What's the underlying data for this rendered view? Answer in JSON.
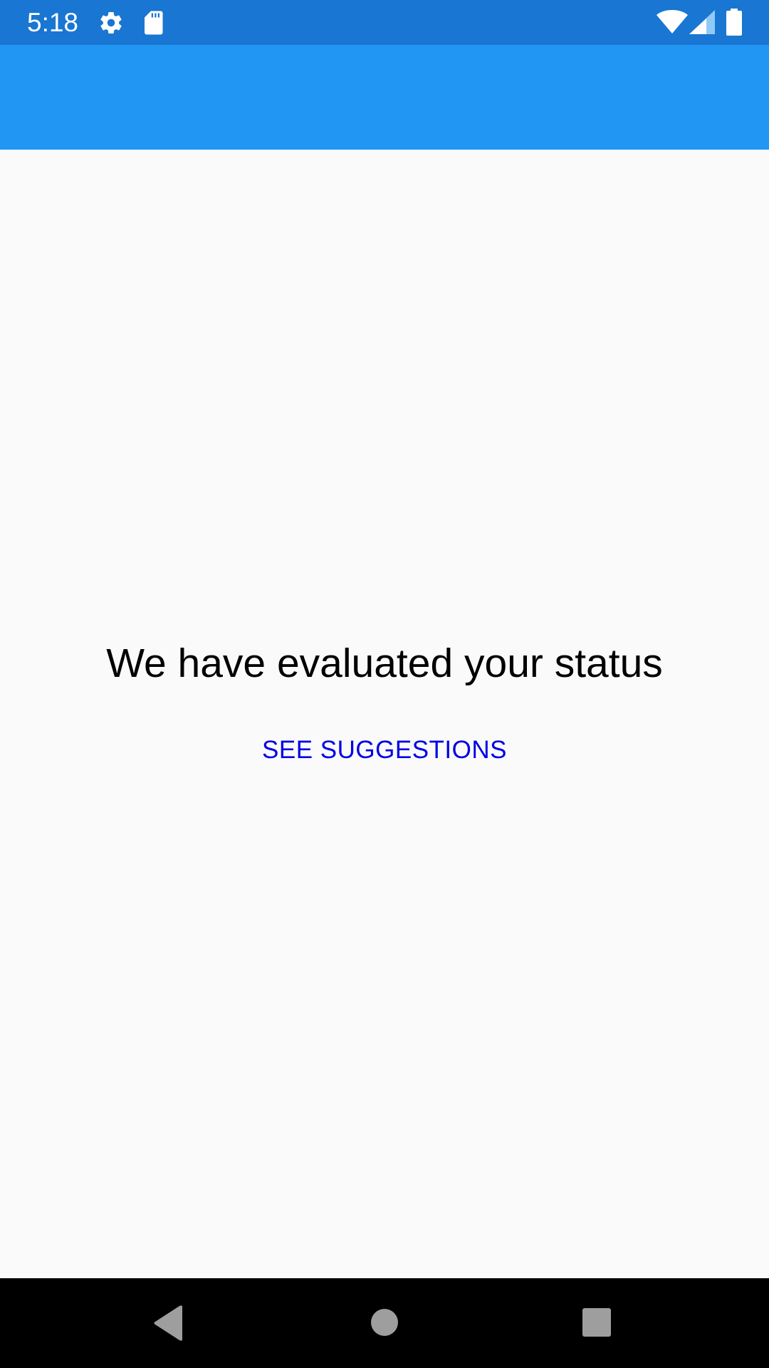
{
  "status_bar": {
    "time": "5:18",
    "icons": [
      "gear-icon",
      "sd-card-icon",
      "wifi-icon",
      "signal-icon",
      "battery-icon"
    ],
    "background": "#1976d2"
  },
  "app_bar": {
    "background": "#2196f3"
  },
  "main": {
    "headline": "We have evaluated your status",
    "suggestions_button": "SEE SUGGESTIONS",
    "button_color": "#0000e6"
  },
  "nav_bar": {
    "icons": [
      "back-icon",
      "home-icon",
      "recents-icon"
    ]
  }
}
